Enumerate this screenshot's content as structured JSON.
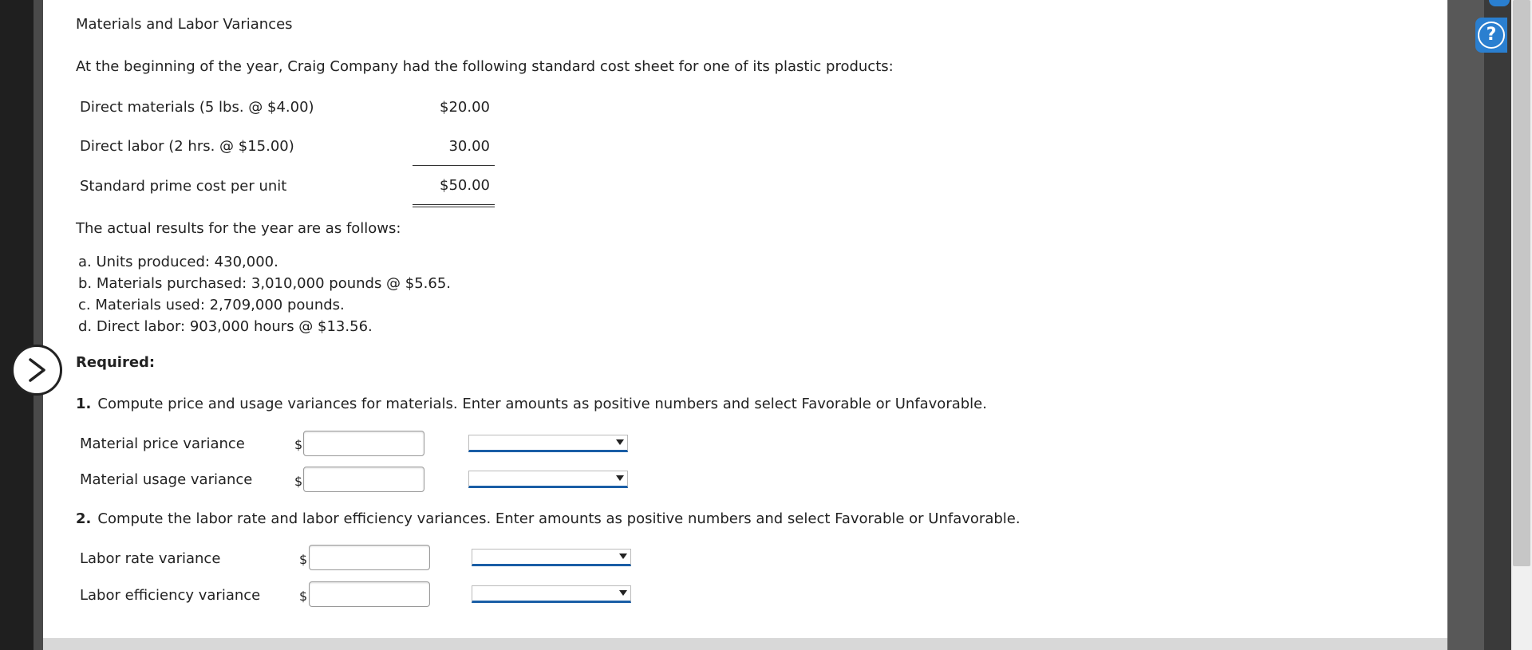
{
  "title": "Materials and Labor Variances",
  "intro": "At the beginning of the year, Craig Company had the following standard cost sheet for one of its plastic products:",
  "cost_sheet": [
    {
      "label": "Direct materials (5 lbs. @ $4.00)",
      "value": "$20.00"
    },
    {
      "label": "Direct labor (2 hrs. @ $15.00)",
      "value": "30.00"
    },
    {
      "label": "Standard prime cost per unit",
      "value": "$50.00"
    }
  ],
  "actual_heading": "The actual results for the year are as follows:",
  "actual_items": [
    "a. Units produced: 430,000.",
    "b. Materials purchased: 3,010,000 pounds @ $5.65.",
    "c. Materials used: 2,709,000 pounds.",
    "d. Direct labor: 903,000 hours @ $13.56."
  ],
  "required_label": "Required:",
  "q1": {
    "number": "1.",
    "text": "Compute price and usage variances for materials. Enter amounts as positive numbers and select Favorable or Unfavorable.",
    "rows": [
      {
        "label": "Material price variance",
        "currency": "$",
        "amount": "",
        "selection": ""
      },
      {
        "label": "Material usage variance",
        "currency": "$",
        "amount": "",
        "selection": ""
      }
    ]
  },
  "q2": {
    "number": "2.",
    "text": "Compute the labor rate and labor efficiency variances. Enter amounts as positive numbers and select Favorable or Unfavorable.",
    "rows": [
      {
        "label": "Labor rate variance",
        "currency": "$",
        "amount": "",
        "selection": ""
      },
      {
        "label": "Labor efficiency variance",
        "currency": "$",
        "amount": "",
        "selection": ""
      }
    ]
  },
  "help_button": {
    "glyph": "?",
    "icon": "help-icon"
  },
  "nav": {
    "icon": "chevron-right-icon"
  },
  "colors": {
    "help_blue": "#2a7fd0",
    "select_underline": "#1a5ea6"
  }
}
